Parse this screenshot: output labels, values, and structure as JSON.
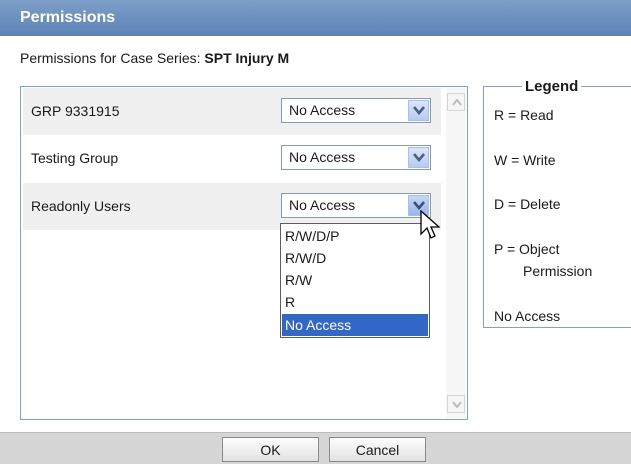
{
  "window": {
    "title": "Permissions"
  },
  "header": {
    "prefix": "Permissions for Case Series:",
    "case_series": "SPT Injury M"
  },
  "rows": [
    {
      "label": "GRP 9331915",
      "value": "No Access"
    },
    {
      "label": "Testing Group",
      "value": "No Access"
    },
    {
      "label": "Readonly Users",
      "value": "No Access"
    }
  ],
  "dropdown": {
    "options": [
      "R/W/D/P",
      "R/W/D",
      "R/W",
      "R",
      "No Access"
    ],
    "selected": "No Access"
  },
  "legend": {
    "title": "Legend",
    "items": [
      "R = Read",
      "W = Write",
      "D = Delete",
      "P = Object",
      "Permission",
      "No Access"
    ]
  },
  "buttons": {
    "ok": "OK",
    "cancel": "Cancel"
  },
  "colors": {
    "titlebar": "#6b8fc0",
    "selection": "#3168c8",
    "border": "#7fa2c8"
  }
}
